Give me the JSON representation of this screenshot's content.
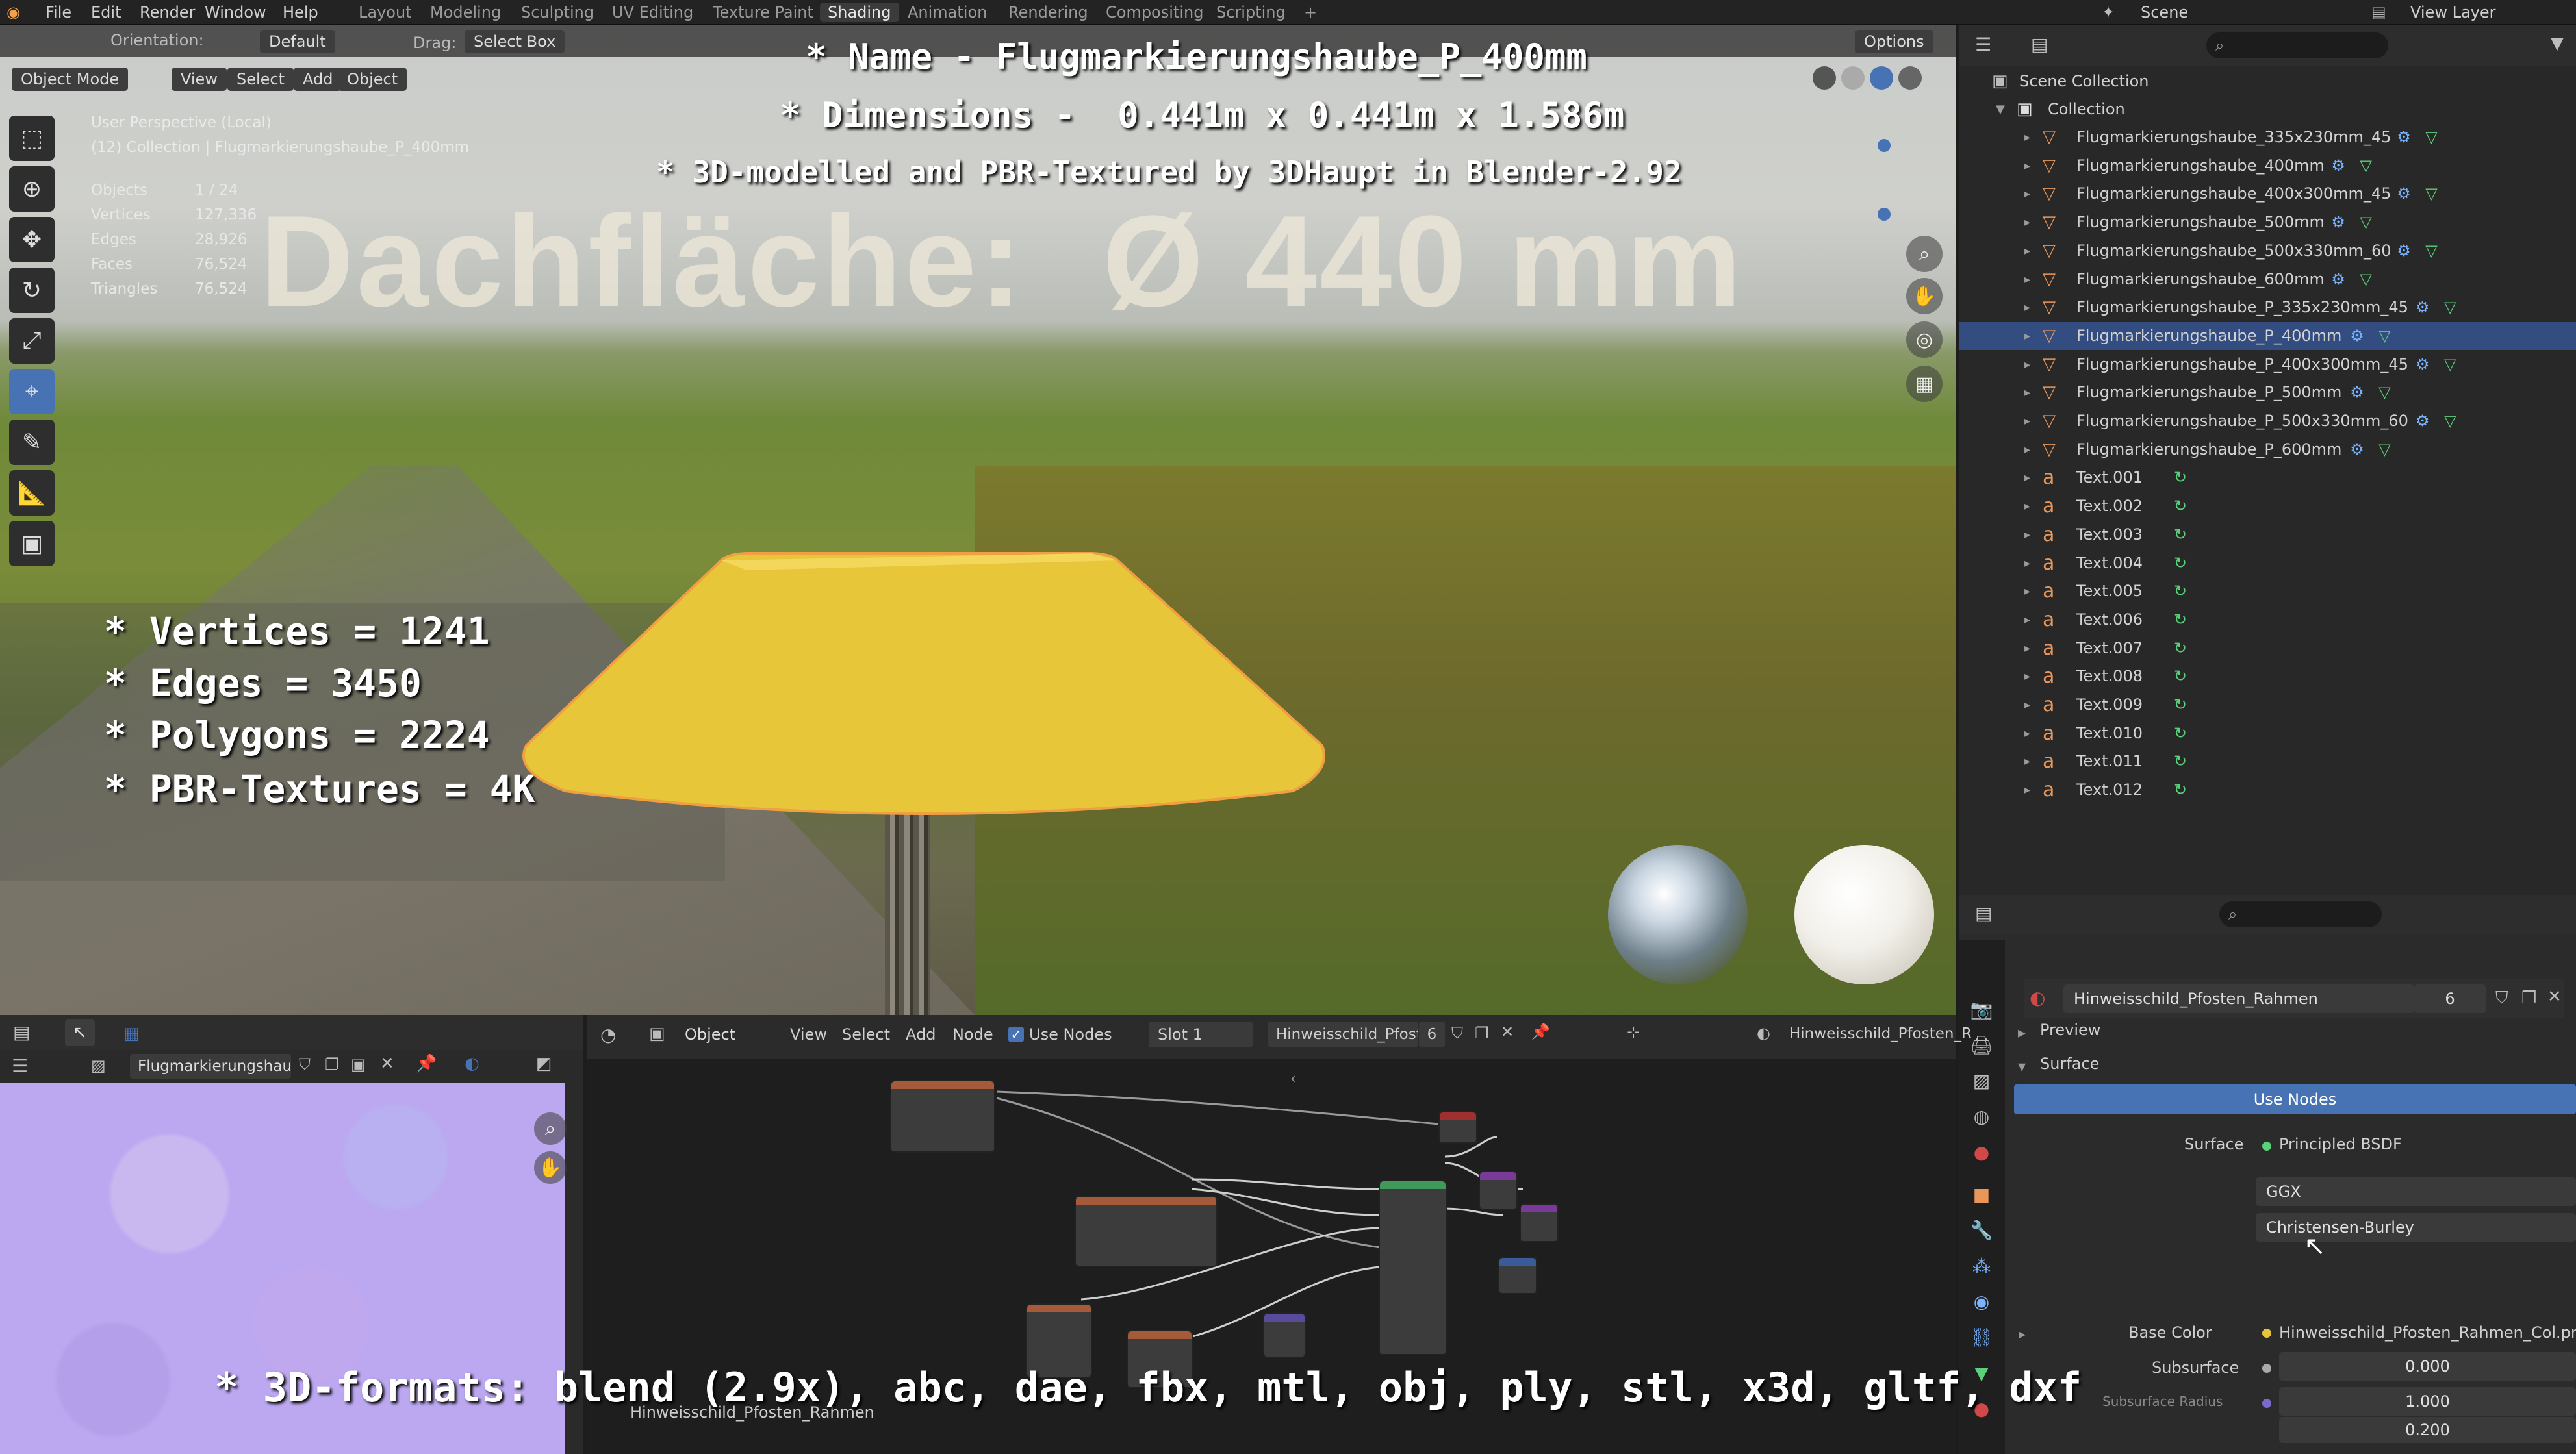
{
  "topbar": {
    "menu": [
      "File",
      "Edit",
      "Render",
      "Window",
      "Help"
    ],
    "workspaces": [
      "Layout",
      "Modeling",
      "Sculpting",
      "UV Editing",
      "Texture Paint",
      "Shading",
      "Animation",
      "Rendering",
      "Compositing",
      "Scripting"
    ],
    "active_workspace": "Shading",
    "add_tab": "+",
    "scene_label": "Scene",
    "view_layer_label": "View Layer"
  },
  "overlay": {
    "name_line": "* Name - Flugmarkierungshaube_P_400mm",
    "dims_line": "* Dimensions -  0.441m x 0.441m x 1.586m",
    "credit_line": "* 3D-modelled and PBR-Textured by 3DHaupt in Blender-2.92",
    "specs": [
      "* Vertices = 1241",
      "* Edges = 3450",
      "* Polygons = 2224",
      "* PBR-Textures = 4K"
    ],
    "formats_line": "* 3D-formats: blend (2.9x), abc, dae, fbx, mtl, obj, ply, stl, x3d, gltf, dxf",
    "background_sign": "Dachfläche:  Ø 440 mm"
  },
  "viewport": {
    "orientation_label": "Orientation:",
    "orientation_value": "Default",
    "drag_label": "Drag:",
    "drag_value": "Select Box",
    "options_label": "Options",
    "mode": "Object Mode",
    "menus": [
      "View",
      "Select",
      "Add",
      "Object"
    ],
    "perspective": "User Perspective (Local)",
    "collection_info": "(12) Collection | Flugmarkierungshaube_P_400mm",
    "stats": [
      {
        "k": "Objects",
        "v": "1 / 24"
      },
      {
        "k": "Vertices",
        "v": "127,336"
      },
      {
        "k": "Edges",
        "v": "28,926"
      },
      {
        "k": "Faces",
        "v": "76,524"
      },
      {
        "k": "Triangles",
        "v": "76,524"
      }
    ]
  },
  "outliner": {
    "scene_collection": "Scene Collection",
    "collection": "Collection",
    "items": [
      {
        "name": "Flugmarkierungshaube_335x230mm_45",
        "type": "mesh",
        "selected": false
      },
      {
        "name": "Flugmarkierungshaube_400mm",
        "type": "mesh",
        "selected": false
      },
      {
        "name": "Flugmarkierungshaube_400x300mm_45",
        "type": "mesh",
        "selected": false
      },
      {
        "name": "Flugmarkierungshaube_500mm",
        "type": "mesh",
        "selected": false
      },
      {
        "name": "Flugmarkierungshaube_500x330mm_60",
        "type": "mesh",
        "selected": false
      },
      {
        "name": "Flugmarkierungshaube_600mm",
        "type": "mesh",
        "selected": false
      },
      {
        "name": "Flugmarkierungshaube_P_335x230mm_45",
        "type": "mesh",
        "selected": false
      },
      {
        "name": "Flugmarkierungshaube_P_400mm",
        "type": "mesh",
        "selected": true
      },
      {
        "name": "Flugmarkierungshaube_P_400x300mm_45",
        "type": "mesh",
        "selected": false
      },
      {
        "name": "Flugmarkierungshaube_P_500mm",
        "type": "mesh",
        "selected": false
      },
      {
        "name": "Flugmarkierungshaube_P_500x330mm_60",
        "type": "mesh",
        "selected": false
      },
      {
        "name": "Flugmarkierungshaube_P_600mm",
        "type": "mesh",
        "selected": false
      },
      {
        "name": "Text.001",
        "type": "text",
        "selected": false
      },
      {
        "name": "Text.002",
        "type": "text",
        "selected": false
      },
      {
        "name": "Text.003",
        "type": "text",
        "selected": false
      },
      {
        "name": "Text.004",
        "type": "text",
        "selected": false
      },
      {
        "name": "Text.005",
        "type": "text",
        "selected": false
      },
      {
        "name": "Text.006",
        "type": "text",
        "selected": false
      },
      {
        "name": "Text.007",
        "type": "text",
        "selected": false
      },
      {
        "name": "Text.008",
        "type": "text",
        "selected": false
      },
      {
        "name": "Text.009",
        "type": "text",
        "selected": false
      },
      {
        "name": "Text.010",
        "type": "text",
        "selected": false
      },
      {
        "name": "Text.011",
        "type": "text",
        "selected": false
      },
      {
        "name": "Text.012",
        "type": "text",
        "selected": false
      }
    ]
  },
  "properties": {
    "material_name": "Hinweisschild_Pfosten_Rahmen",
    "user_count": "6",
    "preview_label": "Preview",
    "surface_section": "Surface",
    "use_nodes_button": "Use Nodes",
    "surface_label": "Surface",
    "surface_value": "Principled BSDF",
    "distribution": "GGX",
    "subsurface_method": "Christensen-Burley",
    "base_color_label": "Base Color",
    "base_color_value": "Hinweisschild_Pfosten_Rahmen_Col.png",
    "subsurface_label": "Subsurface",
    "subsurface_value": "0.000",
    "subsurface_radius_label": "Subsurface Radius",
    "radius_1": "1.000",
    "radius_2": "0.200"
  },
  "image_editor": {
    "image_name": "Flugmarkierungshau..."
  },
  "node_editor": {
    "object_label": "Object",
    "menus": [
      "View",
      "Select",
      "Add",
      "Node"
    ],
    "use_nodes": "Use Nodes",
    "slot": "Slot 1",
    "material_short": "Hinweisschild_Pfost...",
    "user_count": "6",
    "material_breadcrumb": "Hinweisschild_Pfosten_R",
    "frame_label": "Hinweisschild_Pfosten_Rahmen"
  },
  "colors": {
    "accent": "#4772b3",
    "selected_row": "#334d80",
    "object_icon": "#e8965a",
    "mesh_data_icon": "#5bd07a",
    "modifier_icon": "#78b4ff",
    "dome_yellow": "#e8c63a"
  }
}
